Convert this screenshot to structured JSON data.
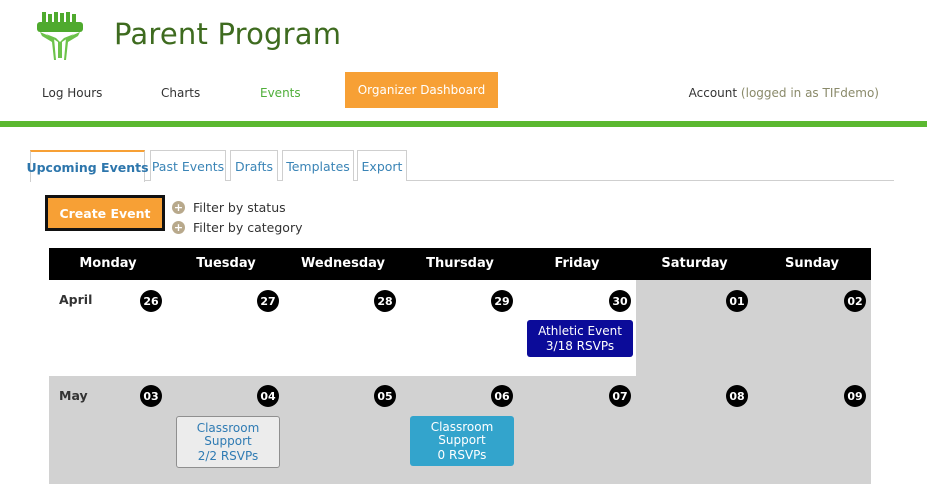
{
  "app": {
    "title": "Parent Program"
  },
  "nav": {
    "log_hours": "Log Hours",
    "charts": "Charts",
    "events": "Events",
    "organizer_dashboard": "Organizer Dashboard",
    "account": "Account",
    "logged_in": "(logged in as TIFdemo)"
  },
  "tabs": [
    "Upcoming Events",
    "Past Events",
    "Drafts",
    "Templates",
    "Export"
  ],
  "actions": {
    "create_event": "Create Event",
    "filter_status": "Filter by status",
    "filter_category": "Filter by category"
  },
  "calendar": {
    "days": [
      "Monday",
      "Tuesday",
      "Wednesday",
      "Thursday",
      "Friday",
      "Saturday",
      "Sunday"
    ],
    "weeks": [
      {
        "month": "April",
        "dates": [
          "26",
          "27",
          "28",
          "29",
          "30",
          "01",
          "02"
        ]
      },
      {
        "month": "May",
        "dates": [
          "03",
          "04",
          "05",
          "06",
          "07",
          "08",
          "09"
        ]
      }
    ],
    "events": [
      {
        "title": "Athletic Event",
        "rsvps": "3/18 RSVPs"
      },
      {
        "title": "Classroom Support",
        "rsvps": "2/2 RSVPs"
      },
      {
        "title": "Classroom Support",
        "rsvps": "0 RSVPs"
      }
    ]
  },
  "colors": {
    "brand_green": "#5bb830",
    "title_green": "#3e6b1f",
    "accent_orange": "#f7a035",
    "event_dark_blue": "#0b0b99",
    "event_light_blue": "#33a4cc"
  }
}
